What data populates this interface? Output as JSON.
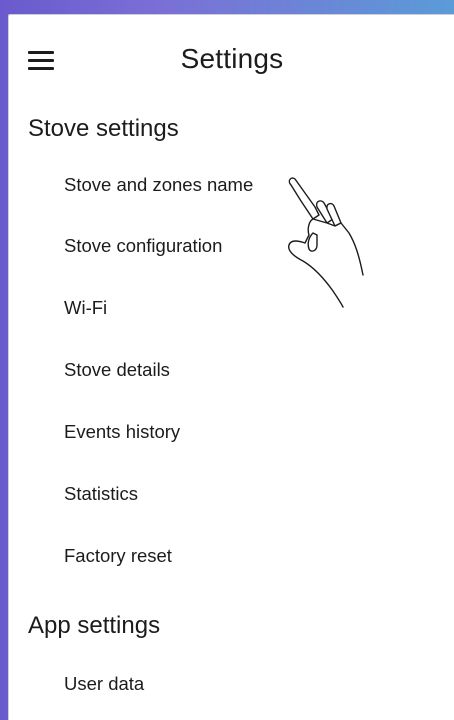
{
  "header": {
    "title": "Settings",
    "menu_icon": "hamburger-menu-icon"
  },
  "stove_section": {
    "title": "Stove settings",
    "items": [
      {
        "label": "Stove and zones name"
      },
      {
        "label": "Stove configuration"
      },
      {
        "label": "Wi-Fi"
      },
      {
        "label": "Stove details"
      },
      {
        "label": "Events history"
      },
      {
        "label": "Statistics"
      },
      {
        "label": "Factory reset"
      }
    ]
  },
  "app_section": {
    "title": "App settings",
    "items": [
      {
        "label": "User data"
      }
    ]
  },
  "overlay": {
    "pointer_icon": "pointing-hand-icon"
  },
  "colors": {
    "text": "#1c1c1c",
    "background": "#ffffff",
    "frame_gradient_start": "#6a5acd",
    "frame_gradient_end": "#5b9bd8"
  }
}
